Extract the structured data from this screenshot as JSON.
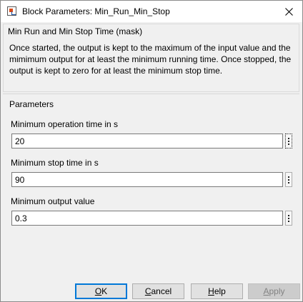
{
  "window": {
    "title": "Block Parameters: Min_Run_Min_Stop"
  },
  "description": {
    "title": "Min Run and Min Stop Time (mask)",
    "text": "Once started, the output is kept to the maximum of the input value and the mimimum output for at least the minimum running time. Once stopped, the output is kept to zero for at least the minimum stop time."
  },
  "parameters": {
    "title": "Parameters",
    "fields": [
      {
        "label": "Minimum operation time in s",
        "value": "20"
      },
      {
        "label": "Minimum stop time in s",
        "value": "90"
      },
      {
        "label": "Minimum output value",
        "value": "0.3"
      }
    ]
  },
  "buttons": {
    "ok": {
      "mnemonic": "O",
      "rest": "K"
    },
    "cancel": {
      "mnemonic": "C",
      "rest": "ancel"
    },
    "help": {
      "mnemonic": "H",
      "rest": "elp"
    },
    "apply": {
      "mnemonic": "A",
      "rest": "pply"
    }
  }
}
